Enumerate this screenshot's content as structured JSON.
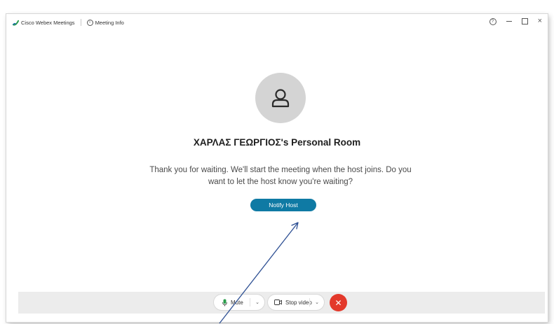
{
  "titlebar": {
    "app_name": "Cisco Webex Meetings",
    "meeting_info": "Meeting Info",
    "help_glyph": "?",
    "close_glyph": "×"
  },
  "room": {
    "title": "ΧΑΡΛΑΣ ΓΕΩΡΓΙΟΣ's Personal Room",
    "message": "Thank you for waiting. We'll start the meeting when the host joins. Do you want to let the host know you're waiting?",
    "notify_label": "Notify Host"
  },
  "controls": {
    "mute_label": "Mute",
    "video_label": "Stop video",
    "chevron": "⌄",
    "end_glyph": "✕"
  },
  "colors": {
    "accent": "#0f7aa4",
    "end_call": "#e3392b",
    "mic_green": "#2a9d4b",
    "annotation_arrow": "#2d4f93"
  },
  "icons": {
    "app_logo": "webex-logo-icon",
    "meeting_info": "info-icon",
    "avatar": "person-icon",
    "mute": "microphone-icon",
    "video": "video-camera-icon",
    "end": "close-icon"
  }
}
